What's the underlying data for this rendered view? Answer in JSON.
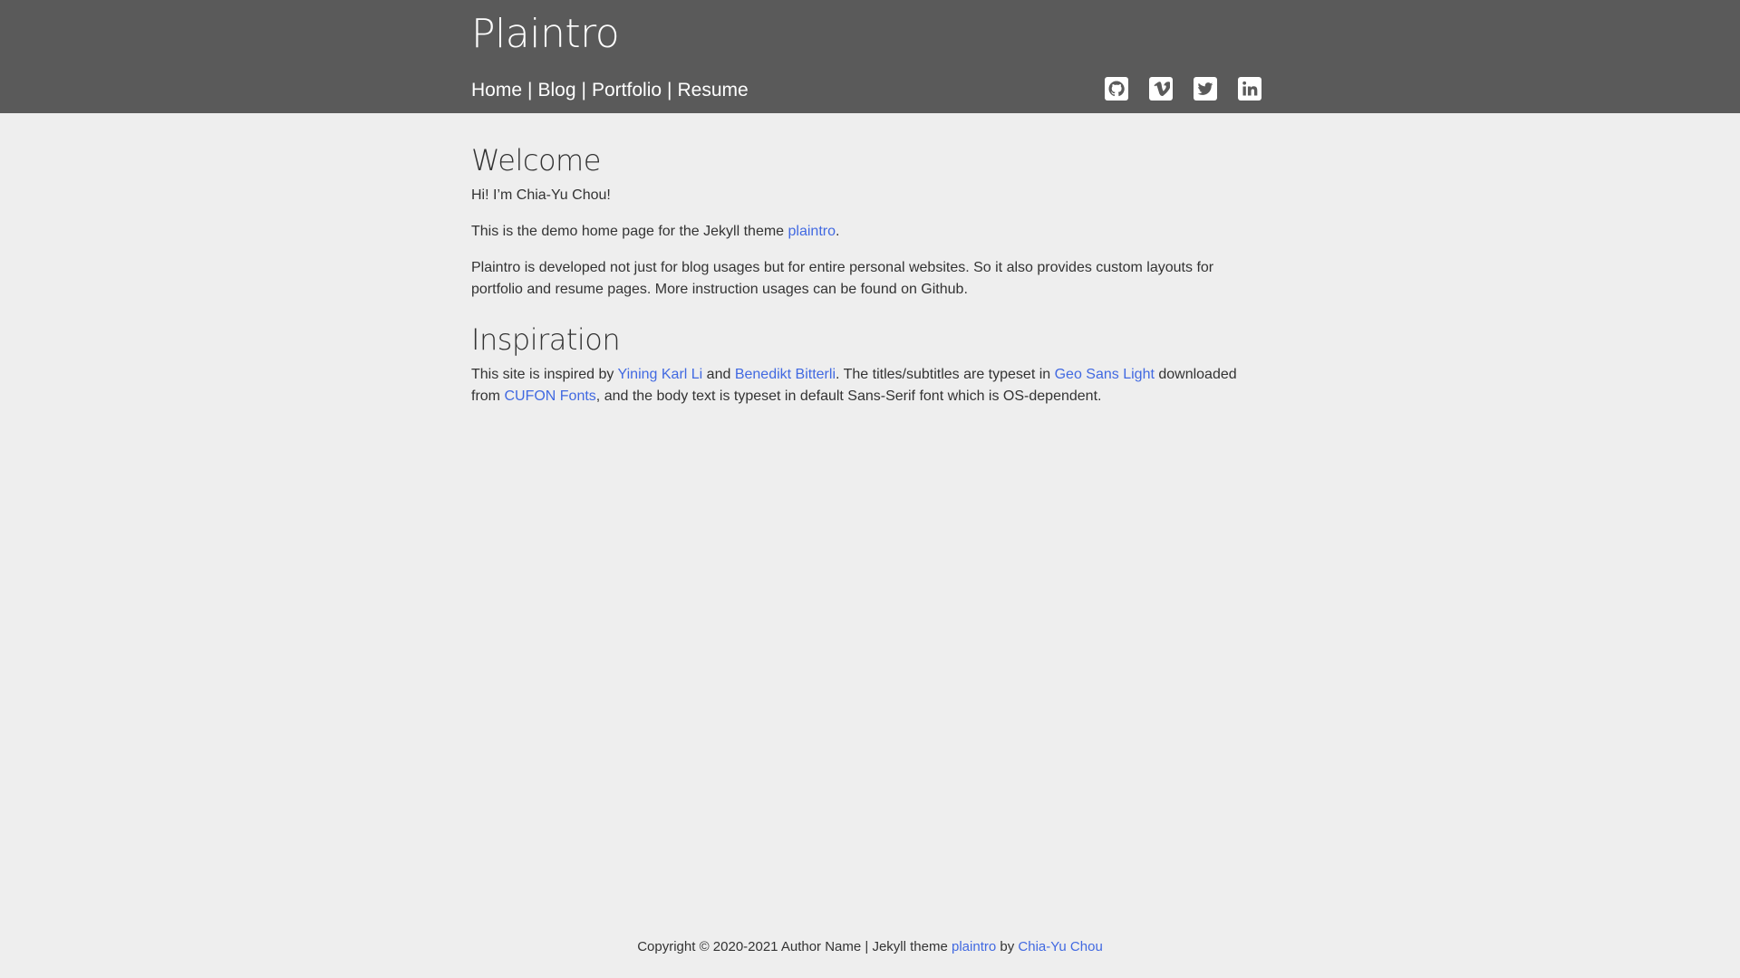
{
  "header": {
    "site_title": "Plaintro",
    "nav": [
      {
        "label": "Home"
      },
      {
        "label": "Blog"
      },
      {
        "label": "Portfolio"
      },
      {
        "label": "Resume"
      }
    ],
    "nav_separator": "|",
    "social": [
      {
        "icon": "github-icon"
      },
      {
        "icon": "vimeo-icon"
      },
      {
        "icon": "twitter-icon"
      },
      {
        "icon": "linkedin-icon"
      }
    ]
  },
  "welcome": {
    "heading": "Welcome",
    "p1": "Hi! I’m Chia-Yu Chou!",
    "p2_before": "This is the demo home page for the Jekyll theme ",
    "p2_link": "plaintro",
    "p2_after": ".",
    "p3": "Plaintro is developed not just for blog usages but for entire personal websites. So it also provides custom layouts for portfolio and resume pages. More instruction usages can be found on Github."
  },
  "inspiration": {
    "heading": "Inspiration",
    "t1": "This site is inspired by ",
    "link1": "Yining Karl Li",
    "t2": " and ",
    "link2": "Benedikt Bitterli",
    "t3": ". The titles/subtitles are typeset in ",
    "link3": "Geo Sans Light",
    "t4": " downloaded from ",
    "link4": "CUFON Fonts",
    "t5": ", and the body text is typeset in default Sans-Serif font which is OS-dependent."
  },
  "footer": {
    "text": "Copyright © 2020-2021 Author Name | Jekyll theme ",
    "link1": "plaintro",
    "mid": " by ",
    "link2": "Chia-Yu Chou"
  },
  "colors": {
    "header_bg": "#5a5a5a",
    "page_bg": "#eeeeee",
    "link": "#4169e1"
  }
}
